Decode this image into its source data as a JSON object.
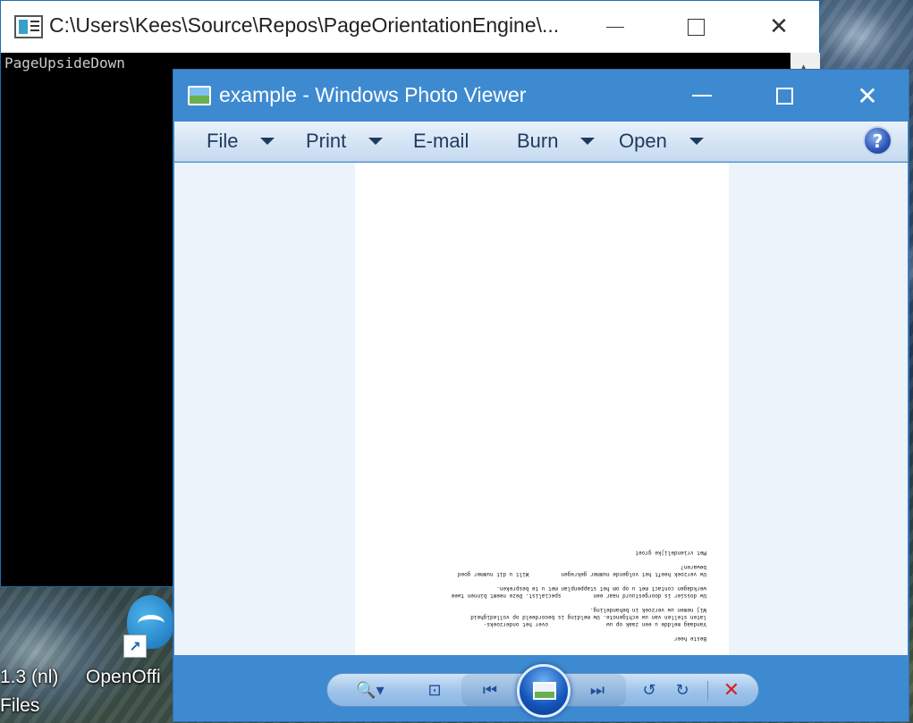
{
  "console": {
    "title": "C:\\Users\\Kees\\Source\\Repos\\PageOrientationEngine\\...",
    "output_line": "PageUpsideDown",
    "minimize_glyph": "",
    "close_glyph": "✕",
    "scroll_up_glyph": "▲"
  },
  "viewer": {
    "title": "example - Windows Photo Viewer",
    "close_glyph": "✕",
    "menu": {
      "file": "File",
      "print": "Print",
      "email": "E-mail",
      "burn": "Burn",
      "open": "Open"
    },
    "help_glyph": "?",
    "page_lines": [
      "Beste heer",
      "Vandaag meldde u een zaak op uw                  over het onderzoeks-\nlaten stellen van uw echtgenote. Uw melding is beoordeeld op volledigheid\nWij nemen uw verzoek in behandeling.",
      "Uw dossier is doorgestuurd naar een          specialist. Deze neemt binnen twee\nwerkdagen contact met u op om het stappenplan met u te bespreken.",
      "Uw verzoek heeft het volgende nummer gekregen          Wilt u dit nummer goed\nbewaren?",
      "Met vriendelijke groet"
    ],
    "toolbar": {
      "zoom_glyph": "🔍▾",
      "fit_glyph": "⊡",
      "prev_glyph": "⏮",
      "next_glyph": "⏭",
      "rotate_left_glyph": "↺",
      "rotate_right_glyph": "↻",
      "delete_glyph": "✕"
    }
  },
  "desktop": {
    "label_line1": "1.3 (nl)",
    "label_line2": "Files",
    "label_openoffice": "OpenOffi",
    "shortcut_glyph": "↗"
  },
  "colors": {
    "accent": "#3d8ad0",
    "menubar": "#d4e4f4",
    "canvas": "#edf3fa"
  }
}
